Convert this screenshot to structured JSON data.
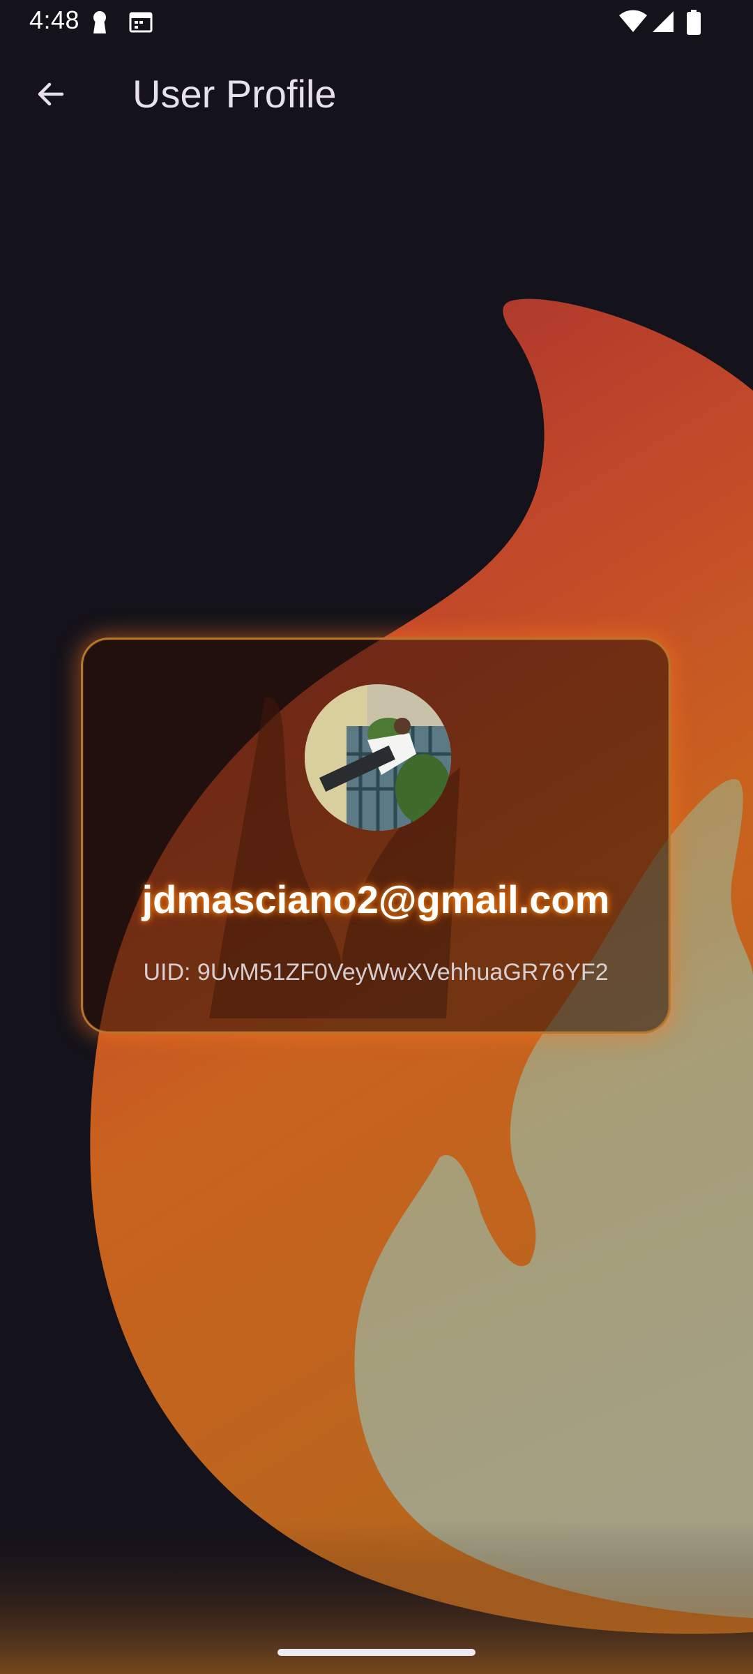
{
  "status_bar": {
    "time": "4:48",
    "icons": [
      "keyhole-notification-icon",
      "calendar-notification-icon",
      "wifi-icon",
      "cell-signal-icon",
      "battery-icon"
    ]
  },
  "app_bar": {
    "back_icon": "arrow-back-icon",
    "title": "User Profile"
  },
  "profile": {
    "email": "jdmasciano2@gmail.com",
    "uid": "UID: 9UvM51ZF0VeyWwXVehhuaGR76YF2",
    "avatar_alt": "user avatar photo"
  },
  "colors": {
    "background": "#14121a",
    "flame_red": "#a0302a",
    "flame_orange": "#d4601f",
    "flame_light": "#a9a585",
    "card_border": "#b9772e",
    "glow": "#ff8c14"
  }
}
